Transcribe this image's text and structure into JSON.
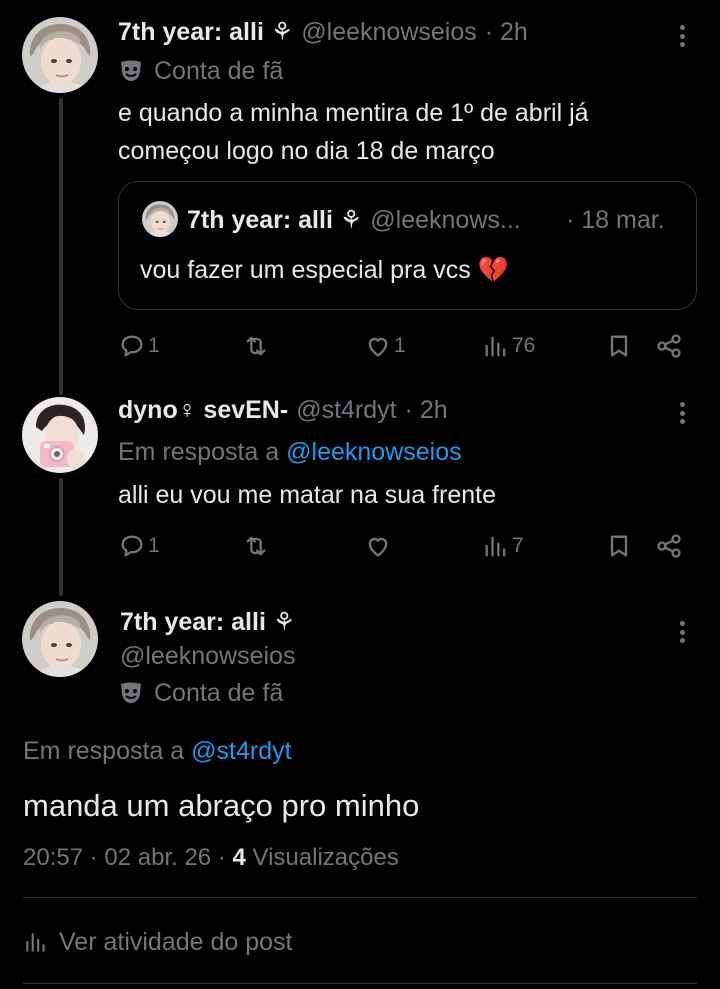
{
  "tweets": [
    {
      "display_name": "7th year: alli ⚘",
      "handle": "@leeknowseios",
      "time": "· 2h",
      "badge": "Conta de fã",
      "text_line1": "e quando a minha mentira de 1º de abril já",
      "text_line2": "começou logo no dia 18 de março",
      "quote": {
        "display_name": "7th year: alli ⚘",
        "handle": "@leeknows...",
        "time": "· 18 mar.",
        "text": "vou fazer um especial pra vcs 💔"
      },
      "replies": "1",
      "likes": "1",
      "views": "76"
    },
    {
      "display_name": "dyno♀︎ sevEN-",
      "handle": "@st4rdyt",
      "time": "· 2h",
      "reply_prefix": "Em resposta a",
      "reply_to": "@leeknowseios",
      "text": "alli eu vou me matar na sua frente",
      "replies": "1",
      "views": "7"
    }
  ],
  "main_tweet": {
    "display_name": "7th year: alli ⚘",
    "handle": "@leeknowseios",
    "badge": "Conta de fã",
    "reply_prefix": "Em resposta a",
    "reply_to": "@st4rdyt",
    "text": "manda um abraço pro minho",
    "timestamp": "20:57 · 02 abr. 26 ·",
    "views_count": "4",
    "views_label": "Visualizações",
    "activity_label": "Ver atividade do post"
  },
  "colors": {
    "background": "#000000",
    "text": "#e7e9ea",
    "muted": "#71767b",
    "link": "#1d9bf0",
    "border": "#2f3336"
  },
  "icons": [
    "comment-icon",
    "retweet-icon",
    "like-icon",
    "views-icon",
    "bookmark-icon",
    "share-icon",
    "more-icon",
    "theater-masks-icon"
  ]
}
